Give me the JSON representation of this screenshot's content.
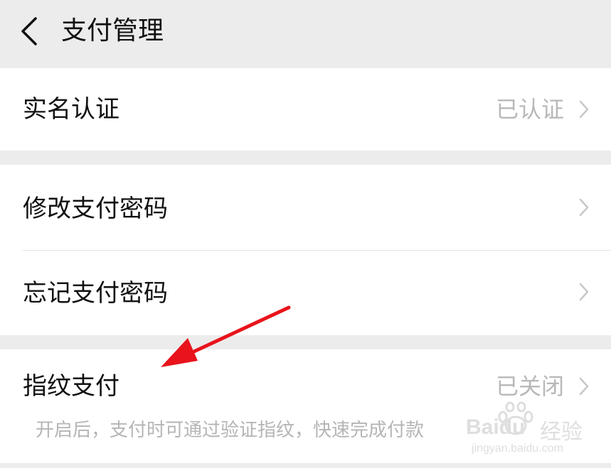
{
  "header": {
    "title": "支付管理"
  },
  "rows": {
    "real_name": {
      "label": "实名认证",
      "value": "已认证"
    },
    "change_password": {
      "label": "修改支付密码"
    },
    "forgot_password": {
      "label": "忘记支付密码"
    },
    "fingerprint": {
      "label": "指纹支付",
      "value": "已关闭",
      "hint": "开启后，支付时可通过验证指纹，快速完成付款"
    }
  },
  "annotation": {
    "arrow_color": "#e8131b"
  },
  "watermark": {
    "brand": "Baidu",
    "suffix": "经验",
    "url": "jingyan.baidu.com"
  }
}
